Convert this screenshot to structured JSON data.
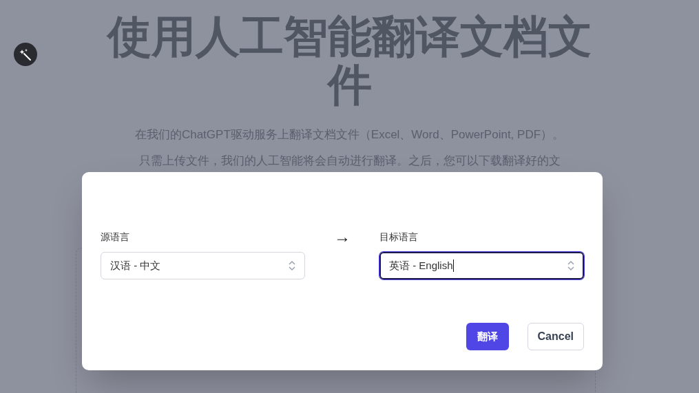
{
  "page": {
    "title": "使用人工智能翻译文档文件",
    "description_lines": [
      "在我们的ChatGPT驱动服务上翻译文档文件（Excel、Word、PowerPoint, PDF）。",
      "只需上传文件，我们的人工智能将会自动进行翻译。之后，您可以下载翻译好的文"
    ]
  },
  "dialog": {
    "fields": [
      {
        "label": "源语言",
        "value": "汉语 - 中文",
        "focused": false
      },
      {
        "label": "目标语言",
        "value": "英语 - English",
        "focused": true
      }
    ],
    "arrow": "→",
    "buttons": [
      {
        "label": "翻译",
        "kind": "primary"
      },
      {
        "label": "Cancel",
        "kind": "secondary"
      }
    ]
  }
}
